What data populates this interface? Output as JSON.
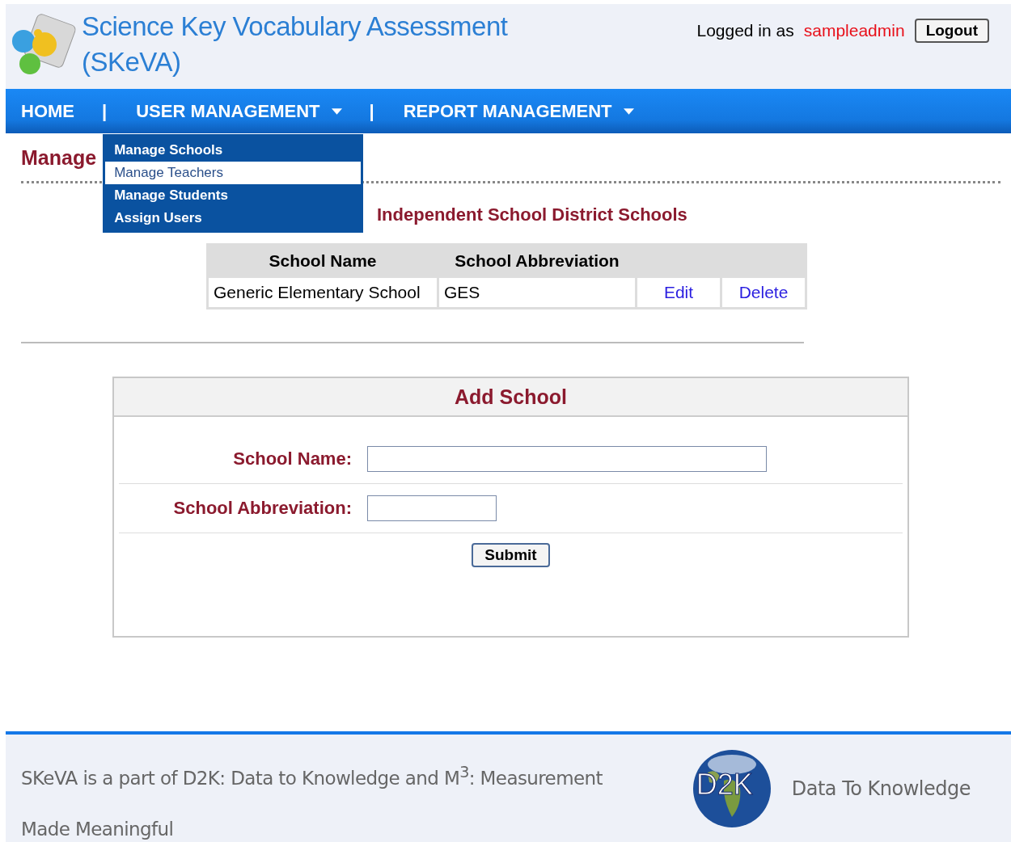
{
  "header": {
    "title_line_1": "Science Key Vocabulary Assessment",
    "title_line_2": "(SKeVA)",
    "logged_in_label": "Logged in as",
    "username": "sampleadmin",
    "logout": "Logout"
  },
  "nav": [
    {
      "label": "HOME",
      "dropdown": false,
      "open": false
    },
    {
      "label": "USER MANAGEMENT",
      "dropdown": true,
      "open": true
    },
    {
      "label": "REPORT MANAGEMENT",
      "dropdown": true,
      "open": false
    }
  ],
  "nav_separator": "|",
  "dropdown_menu": [
    {
      "label": "Manage Schools",
      "selected": false
    },
    {
      "label": "Manage Teachers",
      "selected": true
    },
    {
      "label": "Manage Students",
      "selected": false
    },
    {
      "label": "Assign Users",
      "selected": false
    }
  ],
  "page_title": "Manage",
  "section_title": "Independent School District Schools",
  "table": {
    "columns": [
      "School Name",
      "School Abbreviation"
    ],
    "rows": [
      {
        "school_name": "Generic Elementary School",
        "abbreviation": "GES",
        "actions": [
          "Edit",
          "Delete"
        ]
      }
    ]
  },
  "add_form": {
    "title": "Add School",
    "fields": [
      {
        "label": "School Name:"
      },
      {
        "label": "School Abbreviation:"
      }
    ],
    "submit": "Submit"
  },
  "footer": {
    "text": "SKeVA is a part of D2K: Data to Knowledge and M$^{3}$: Measurement Made Meaningful",
    "logo_text": "D2K",
    "logo_caption": "Data To Knowledge"
  }
}
